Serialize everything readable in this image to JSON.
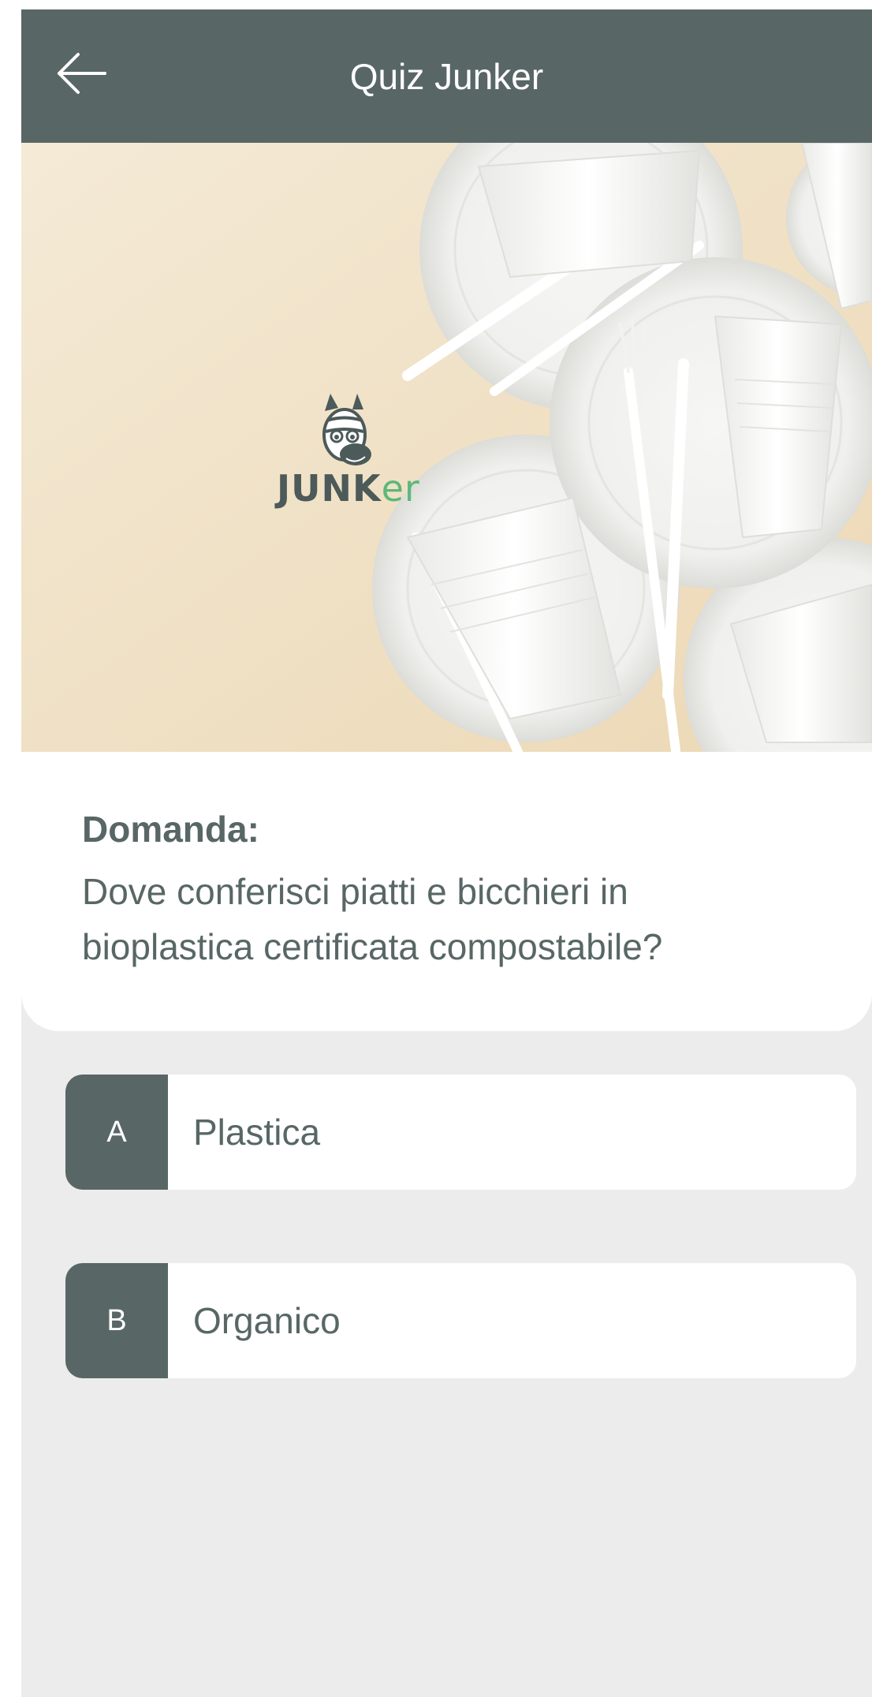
{
  "header": {
    "title": "Quiz Junker",
    "back_icon": "arrow-left-icon"
  },
  "hero": {
    "logo_text": "JUNKER",
    "logo_text_a": "JUNK",
    "logo_text_b": "er",
    "image_subject": "compostable bioplastic plates, cups and cutlery on beige background"
  },
  "question": {
    "label": "Domanda:",
    "line1": "Dove conferisci piatti e bicchieri in",
    "line2": "bioplastica certificata compostabile?"
  },
  "answers": [
    {
      "letter": "A",
      "text": "Plastica"
    },
    {
      "letter": "B",
      "text": "Organico"
    }
  ],
  "colors": {
    "primary": "#586766",
    "background": "#ececec",
    "card": "#ffffff",
    "logo_accent": "#5cb87a"
  }
}
